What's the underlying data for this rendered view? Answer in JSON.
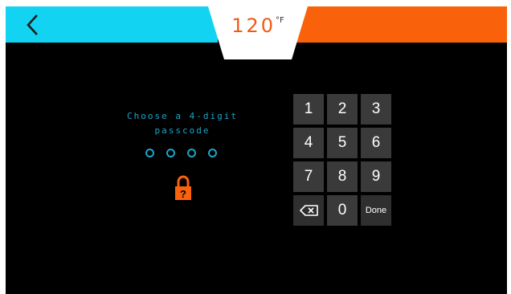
{
  "header": {
    "back_icon": "chevron-left-icon",
    "temperature_value": "120",
    "temperature_unit": "°F",
    "colors": {
      "left_bar": "#12d3f2",
      "right_bar": "#f9620b",
      "temperature": "#f15a13"
    }
  },
  "passcode": {
    "prompt_line1": "Choose a 4-digit",
    "prompt_line2": "passcode",
    "entered_digits": 0,
    "total_digits": 4,
    "lock_icon": "lock-question-icon",
    "accent_color": "#1aa7c8"
  },
  "keypad": {
    "keys": [
      "1",
      "2",
      "3",
      "4",
      "5",
      "6",
      "7",
      "8",
      "9",
      "",
      "0",
      "Done"
    ],
    "backspace_icon": "backspace-icon",
    "done_label": "Done"
  }
}
